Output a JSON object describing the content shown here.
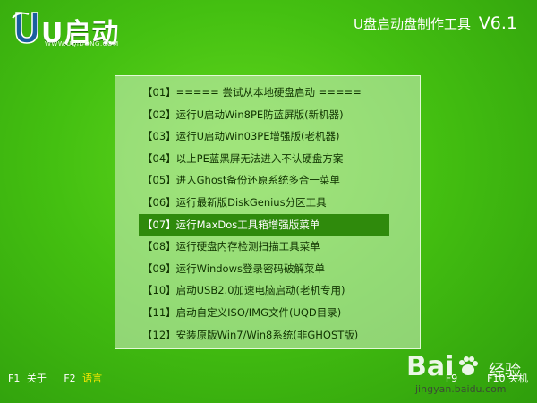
{
  "logo": {
    "brand": "U启动",
    "domain": "WWW.UQIDONG.COM"
  },
  "header": {
    "title": "U盘启动盘制作工具",
    "version": "V6.1"
  },
  "menu": {
    "selected_index": 6,
    "items": [
      "【01】===== 尝试从本地硬盘启动 =====",
      "【02】运行U启动Win8PE防蓝屏版(新机器)",
      "【03】运行U启动Win03PE增强版(老机器)",
      "【04】以上PE蓝黑屏无法进入不认硬盘方案",
      "【05】进入Ghost备份还原系统多合一菜单",
      "【06】运行最新版DiskGenius分区工具",
      "【07】运行MaxDos工具箱增强版菜单",
      "【08】运行硬盘内存检测扫描工具菜单",
      "【09】运行Windows登录密码破解菜单",
      "【10】启动USB2.0加速电脑启动(老机专用)",
      "【11】启动自定义ISO/IMG文件(UQD目录)",
      "【12】安装原版Win7/Win8系统(非GHOST版)"
    ]
  },
  "footer": {
    "f1_key": "F1",
    "f1_label": "关于",
    "f2_key": "F2",
    "f2_label": "语言",
    "f9_key": "F9",
    "f10_key": "F10",
    "f10_label": "关机"
  },
  "watermark": {
    "brand": "Bai",
    "brand2": "经验",
    "url": "jingyan.baidu.com"
  },
  "colors": {
    "background": "#44c011",
    "selected_row": "#2f8a0c",
    "f2_label": "#ffea00"
  }
}
